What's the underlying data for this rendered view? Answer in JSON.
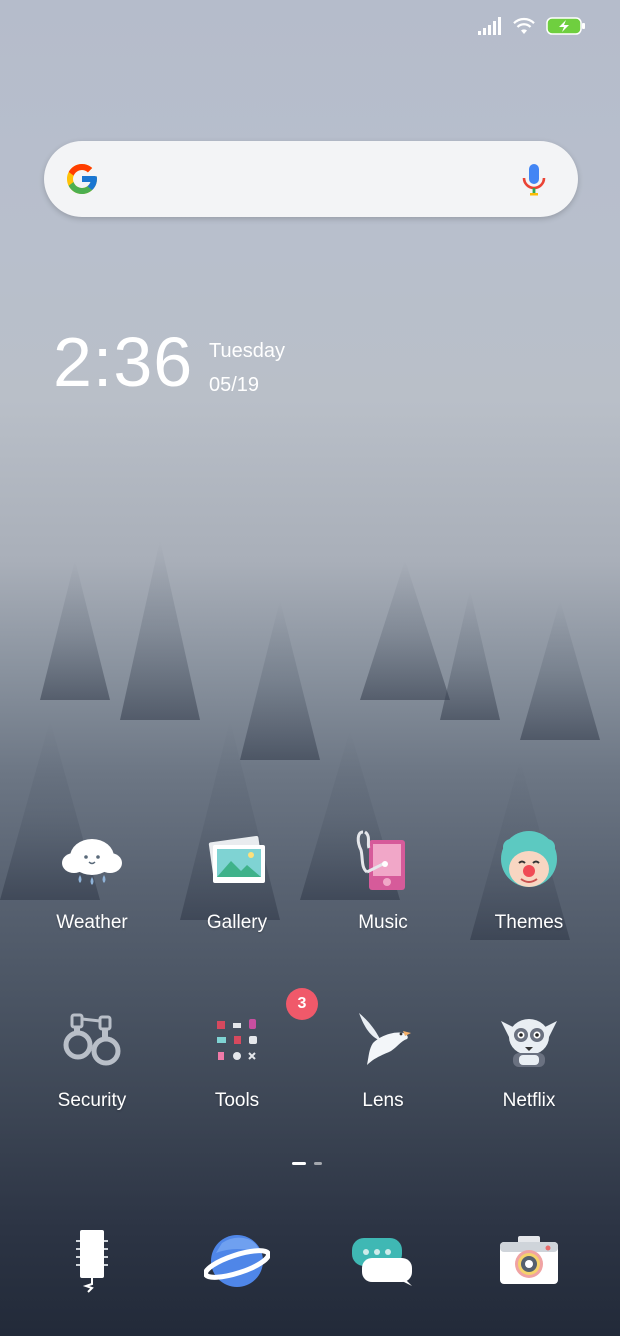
{
  "status_bar": {
    "signal_icon": "signal-bars-icon",
    "wifi_icon": "wifi-icon",
    "battery_icon": "battery-charging-icon",
    "battery_color": "#6fcf3f"
  },
  "search": {
    "placeholder": "",
    "logo_icon": "google-logo-icon",
    "mic_icon": "microphone-icon"
  },
  "clock": {
    "time": "2:36",
    "day": "Tuesday",
    "date": "05/19"
  },
  "apps": [
    {
      "label": "Weather",
      "icon": "weather-cloud-icon"
    },
    {
      "label": "Gallery",
      "icon": "gallery-photos-icon"
    },
    {
      "label": "Music",
      "icon": "music-player-icon"
    },
    {
      "label": "Themes",
      "icon": "themes-clown-icon"
    },
    {
      "label": "Security",
      "icon": "handcuffs-icon"
    },
    {
      "label": "Tools",
      "icon": "tools-folder-icon",
      "badge": "3"
    },
    {
      "label": "Lens",
      "icon": "dove-icon"
    },
    {
      "label": "Netflix",
      "icon": "lemur-icon"
    }
  ],
  "pager": {
    "pages": 2,
    "current": 1
  },
  "dock": [
    {
      "icon": "phone-icon"
    },
    {
      "icon": "browser-planet-icon"
    },
    {
      "icon": "messages-bubbles-icon"
    },
    {
      "icon": "camera-icon"
    }
  ],
  "colors": {
    "badge": "#f0596a",
    "search_bg": "#f3f4f6"
  }
}
